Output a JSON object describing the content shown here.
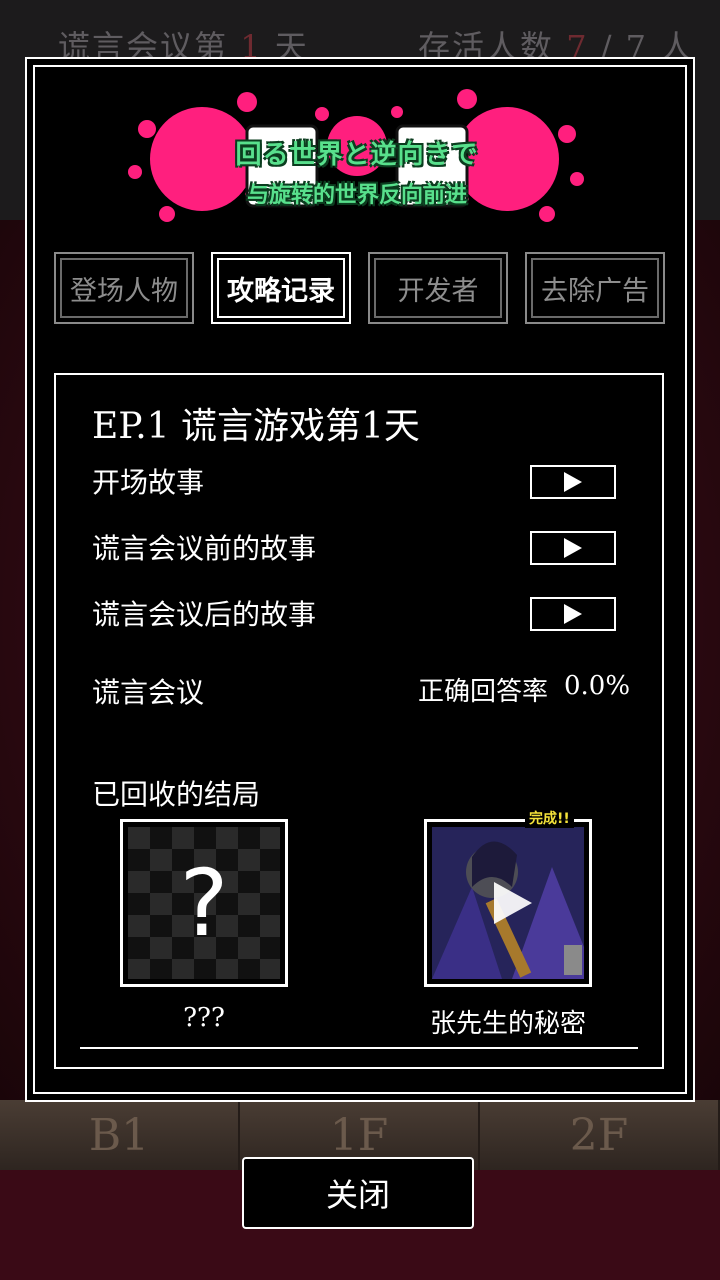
{
  "status": {
    "day_label_prefix": "谎言会议第",
    "day_number": "1",
    "day_label_suffix": "天",
    "alive_label": "存活人数",
    "alive_count": "7",
    "alive_total": "/ 7 人"
  },
  "floors": [
    "B1",
    "1F",
    "2F"
  ],
  "logo": {
    "title_jp": "回る世界と逆向きで",
    "title_cn": "与旋转的世界反向前进",
    "splat_color": "#ff1f7e",
    "text_color": "#58e08c"
  },
  "tabs": [
    {
      "label": "登场人物",
      "active": false
    },
    {
      "label": "攻略记录",
      "active": true
    },
    {
      "label": "开发者",
      "active": false
    },
    {
      "label": "去除广告",
      "active": false
    }
  ],
  "episode": {
    "title": "EP.1  谎言游戏第1天",
    "stories": [
      {
        "label": "开场故事"
      },
      {
        "label": "谎言会议前的故事"
      },
      {
        "label": "谎言会议后的故事"
      }
    ],
    "meeting_label": "谎言会议",
    "correct_rate_label": "正确回答率",
    "correct_rate_value": "0.0%"
  },
  "endings": {
    "title": "已回收的结局",
    "items": [
      {
        "name": "???",
        "locked": true,
        "placeholder_glyph": "?"
      },
      {
        "name": "张先生的秘密",
        "locked": false,
        "badge": "完成!!"
      }
    ]
  },
  "close_label": "关闭"
}
